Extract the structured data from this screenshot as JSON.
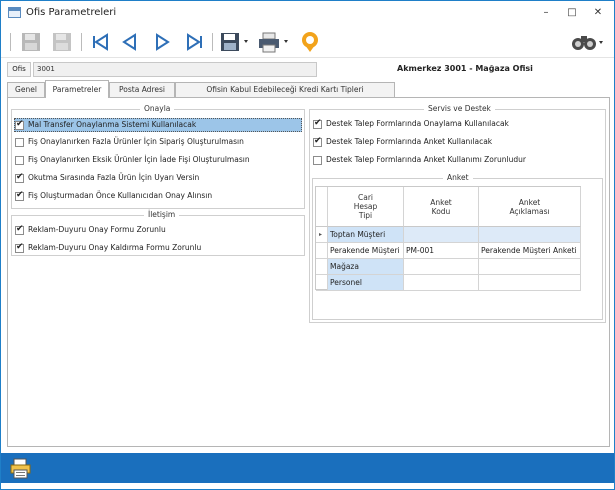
{
  "window": {
    "title": "Ofis Parametreleri",
    "minimize": "–",
    "maximize": "□",
    "close": "✕"
  },
  "toolbar": {
    "icons": [
      "save-icon",
      "delete-icon",
      "first-record-icon",
      "prev-record-icon",
      "next-record-icon",
      "last-record-icon",
      "export-icon",
      "print-icon",
      "location-icon",
      "search-icon"
    ]
  },
  "office": {
    "label": "Ofis",
    "code": "3001",
    "name": "Akmerkez 3001 - Mağaza Ofisi"
  },
  "tabs": [
    "Genel",
    "Parametreler",
    "Posta Adresi",
    "Ofisin Kabul Edebileceği Kredi Kartı Tipleri"
  ],
  "onayla": {
    "title": "Onayla",
    "items": [
      {
        "label": "Mal Transfer Onaylanma Sistemi Kullanılacak",
        "checked": true,
        "selected": true
      },
      {
        "label": "Fiş Onaylanırken Fazla Ürünler İçin Sipariş Oluşturulmasın",
        "checked": false
      },
      {
        "label": "Fiş Onaylanırken Eksik Ürünler İçin İade Fişi Oluşturulmasın",
        "checked": false
      },
      {
        "label": "Okutma Sırasında Fazla Ürün İçin Uyarı Versin",
        "checked": true
      },
      {
        "label": "Fiş Oluşturmadan Önce Kullanıcıdan Onay Alınsın",
        "checked": true
      }
    ]
  },
  "iletisim": {
    "title": "İletişim",
    "items": [
      {
        "label": "Reklam-Duyuru Onay Formu Zorunlu",
        "checked": true
      },
      {
        "label": "Reklam-Duyuru Onay Kaldırma Formu Zorunlu",
        "checked": true
      }
    ]
  },
  "servis": {
    "title": "Servis ve Destek",
    "items": [
      {
        "label": "Destek Talep Formlarında Onaylama Kullanılacak",
        "checked": true
      },
      {
        "label": "Destek Talep Formlarında Anket Kullanılacak",
        "checked": true
      },
      {
        "label": "Destek Talep Formlarında Anket Kullanımı Zorunludur",
        "checked": false
      }
    ]
  },
  "anket": {
    "title": "Anket",
    "columns": [
      "Cari\nHesap\nTipi",
      "Anket\nKodu",
      "Anket\nAçıklaması"
    ],
    "rows": [
      {
        "type": "Toptan Müşteri",
        "code": "",
        "desc": ""
      },
      {
        "type": "Perakende Müşteri",
        "code": "PM-001",
        "desc": "Perakende Müşteri Anketi"
      },
      {
        "type": "Mağaza",
        "code": "",
        "desc": ""
      },
      {
        "type": "Personel",
        "code": "",
        "desc": ""
      }
    ]
  },
  "colors": {
    "accent": "#1a6fbd",
    "selected_row": "#9cc5e8",
    "grid_type_cell": "#cfe3f7"
  }
}
